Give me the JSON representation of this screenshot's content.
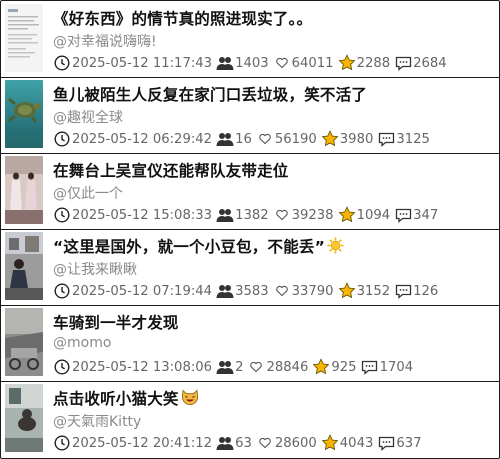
{
  "rows": [
    {
      "title": "《好东西》的情节真的照进现实了。。",
      "author": "@对幸福说嗨嗨!",
      "time": "2025-05-12 11:17:43",
      "followers": "1403",
      "likes": "64011",
      "stars": "2288",
      "comments": "2684",
      "thumb_icon": "document-screenshot-thumbnail"
    },
    {
      "title": "鱼儿被陌生人反复在家门口丢垃圾，笑不活了",
      "author": "@趣视全球",
      "time": "2025-05-12 06:29:42",
      "followers": "16",
      "likes": "56190",
      "stars": "3980",
      "comments": "3125",
      "thumb_icon": "turtle-underwater-thumbnail"
    },
    {
      "title": "在舞台上吴宣仪还能帮队友带走位",
      "author": "@仅此一个",
      "time": "2025-05-12 15:08:33",
      "followers": "1382",
      "likes": "39238",
      "stars": "1094",
      "comments": "347",
      "thumb_icon": "stage-performers-thumbnail"
    },
    {
      "title": "“这里是国外，就一个小豆包，不能丢”",
      "author": "@让我来瞅瞅",
      "time": "2025-05-12 07:19:44",
      "followers": "3583",
      "likes": "33790",
      "stars": "3152",
      "comments": "126",
      "thumb_icon": "street-scene-thumbnail",
      "title_emoji": "sun-emoji"
    },
    {
      "title": "车骑到一半才发现",
      "author": "@momo",
      "time": "2025-05-12 13:08:06",
      "followers": "2",
      "likes": "28846",
      "stars": "925",
      "comments": "1704",
      "thumb_icon": "bike-ride-thumbnail"
    },
    {
      "title": "点击收听小猫大笑",
      "author": "@天氣雨Kitty",
      "time": "2025-05-12 20:41:12",
      "followers": "63",
      "likes": "28600",
      "stars": "4043",
      "comments": "637",
      "thumb_icon": "cat-room-thumbnail",
      "title_emoji": "laughing-cat-emoji"
    }
  ]
}
